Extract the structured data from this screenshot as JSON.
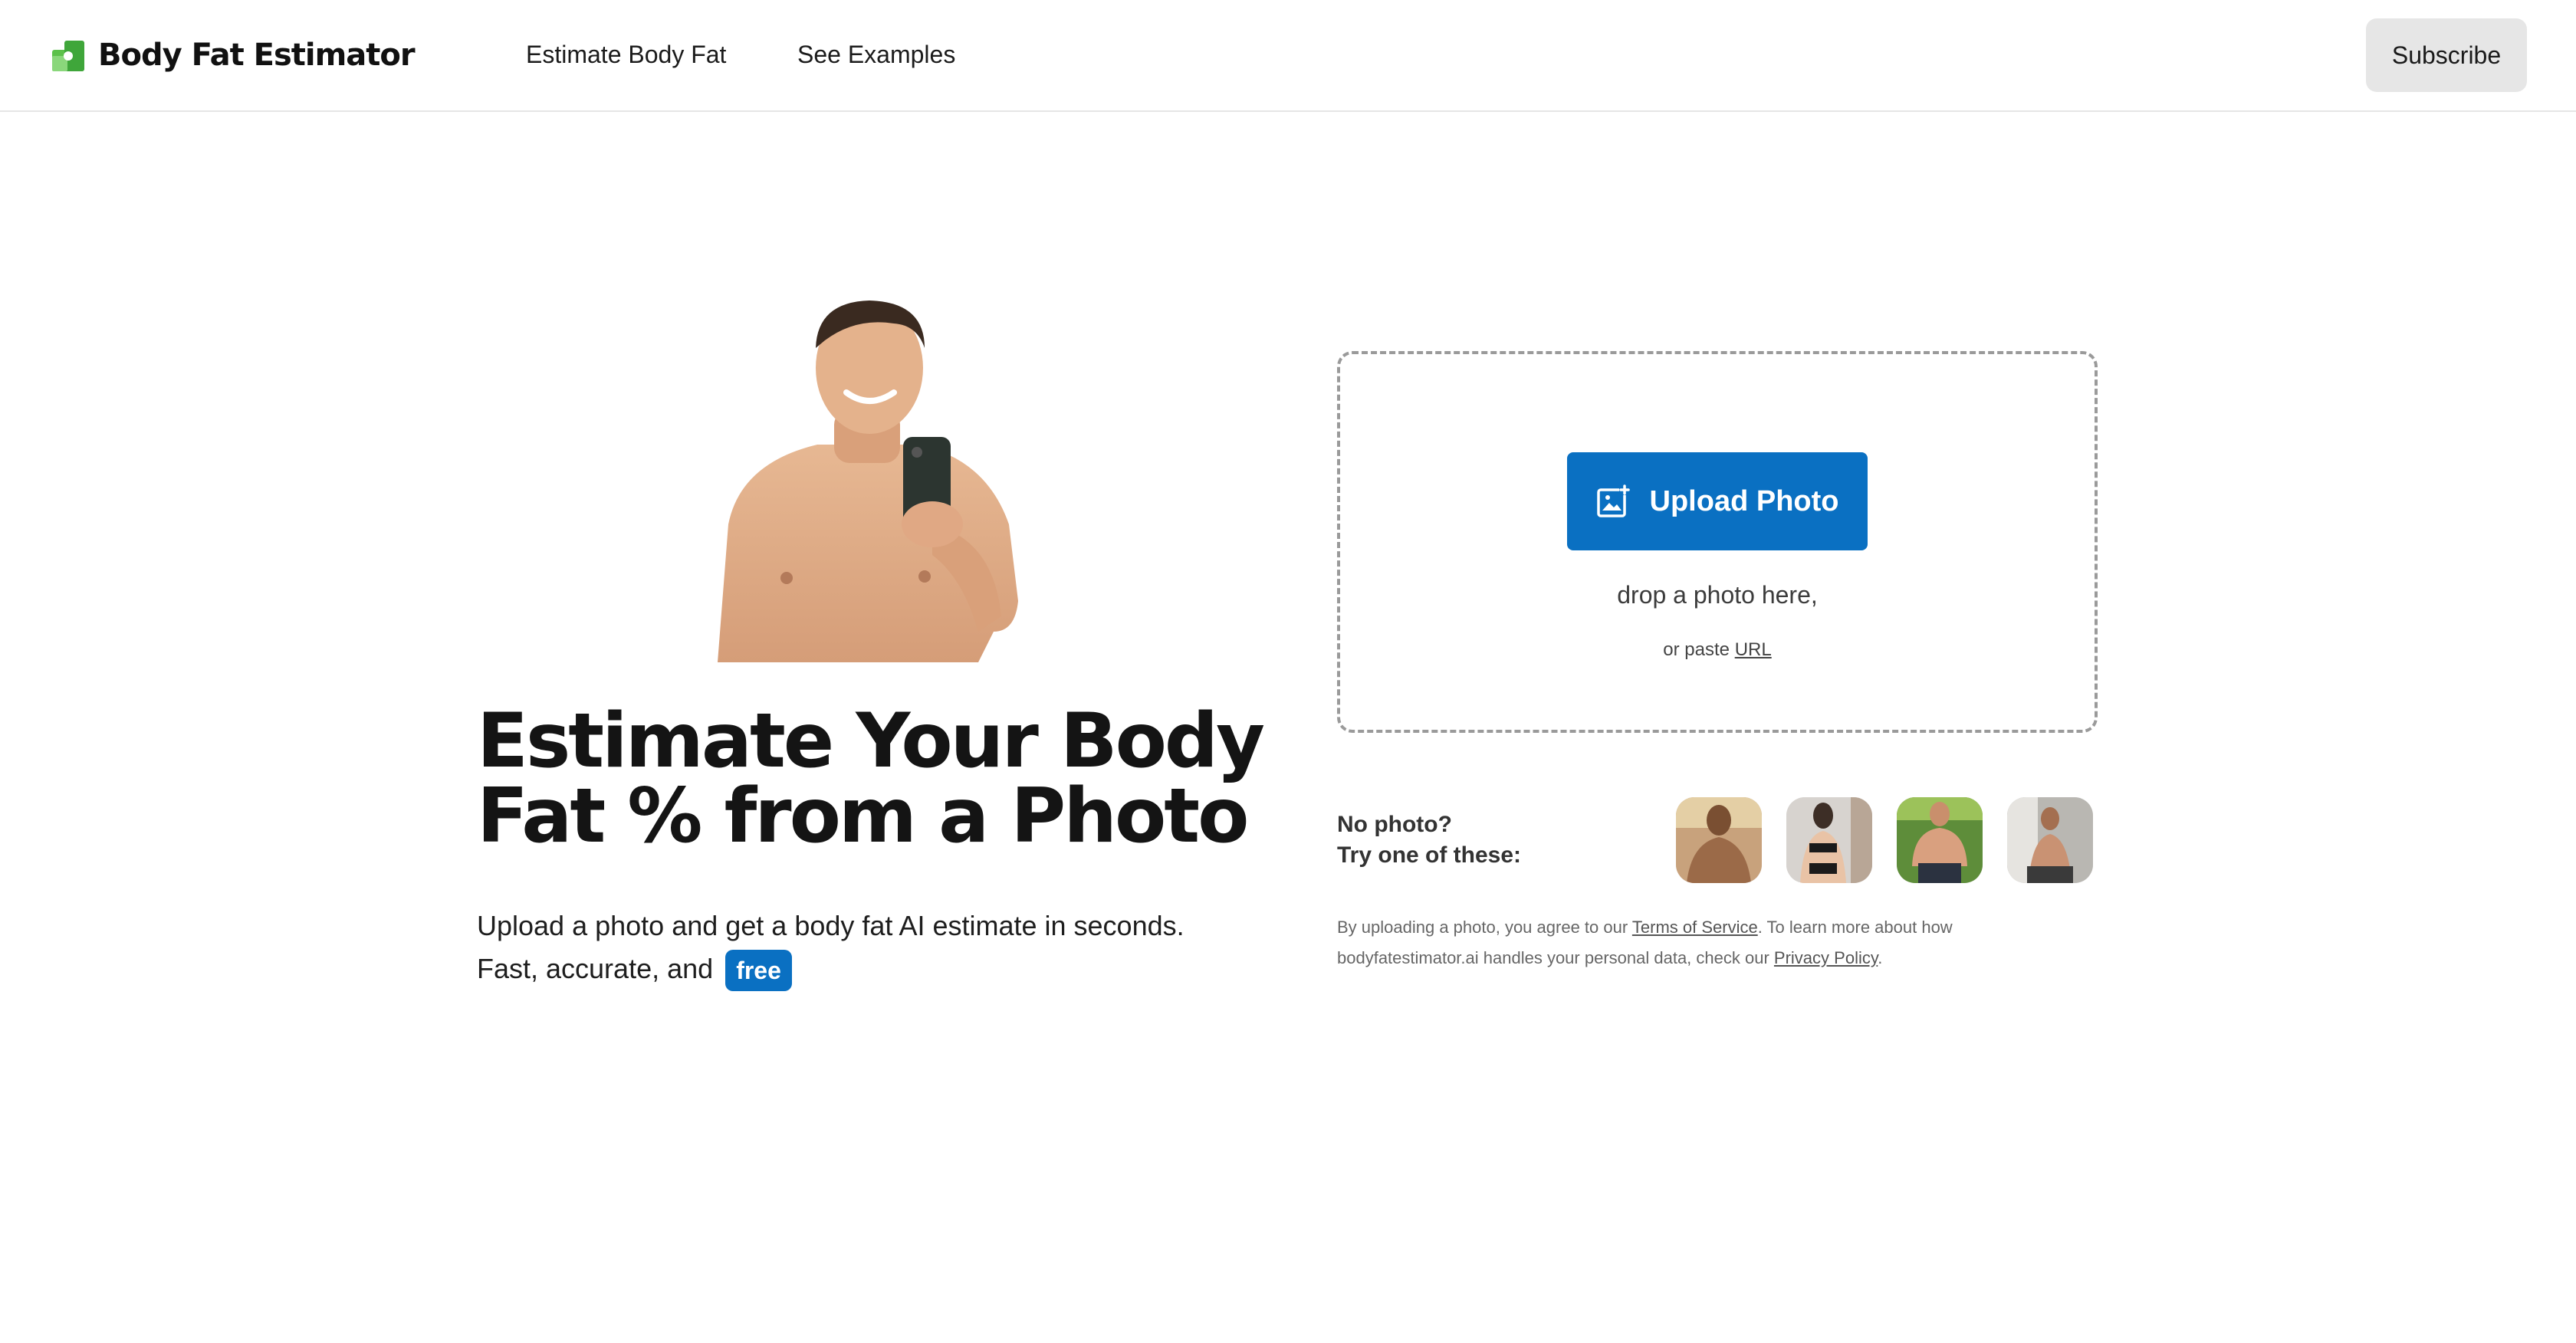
{
  "header": {
    "brand": "Body Fat Estimator",
    "nav": [
      "Estimate Body Fat",
      "See Examples"
    ],
    "subscribe_label": "Subscribe"
  },
  "hero": {
    "title_line1": "Estimate Your Body",
    "title_line2": "Fat % from a Photo",
    "subtitle": "Upload a photo and get a body fat AI estimate in seconds. Fast, accurate, and",
    "badge": "free"
  },
  "upload": {
    "button_label": "Upload Photo",
    "drop_text": "drop a photo here,",
    "paste_prefix": "or paste",
    "paste_link": "URL"
  },
  "samples": {
    "line1": "No photo?",
    "line2": "Try one of these:",
    "count": 4
  },
  "legal": {
    "part1": "By uploading a photo, you agree to our",
    "tos_link": "Terms of Service",
    "part2": ". To learn more about how bodyfatestimator.ai handles your personal data, check our",
    "privacy_link": "Privacy Policy",
    "part3": "."
  },
  "colors": {
    "accent": "#0a70c2",
    "logo_green": "#5cc14a",
    "subscribe_bg": "#e6e6e6"
  }
}
